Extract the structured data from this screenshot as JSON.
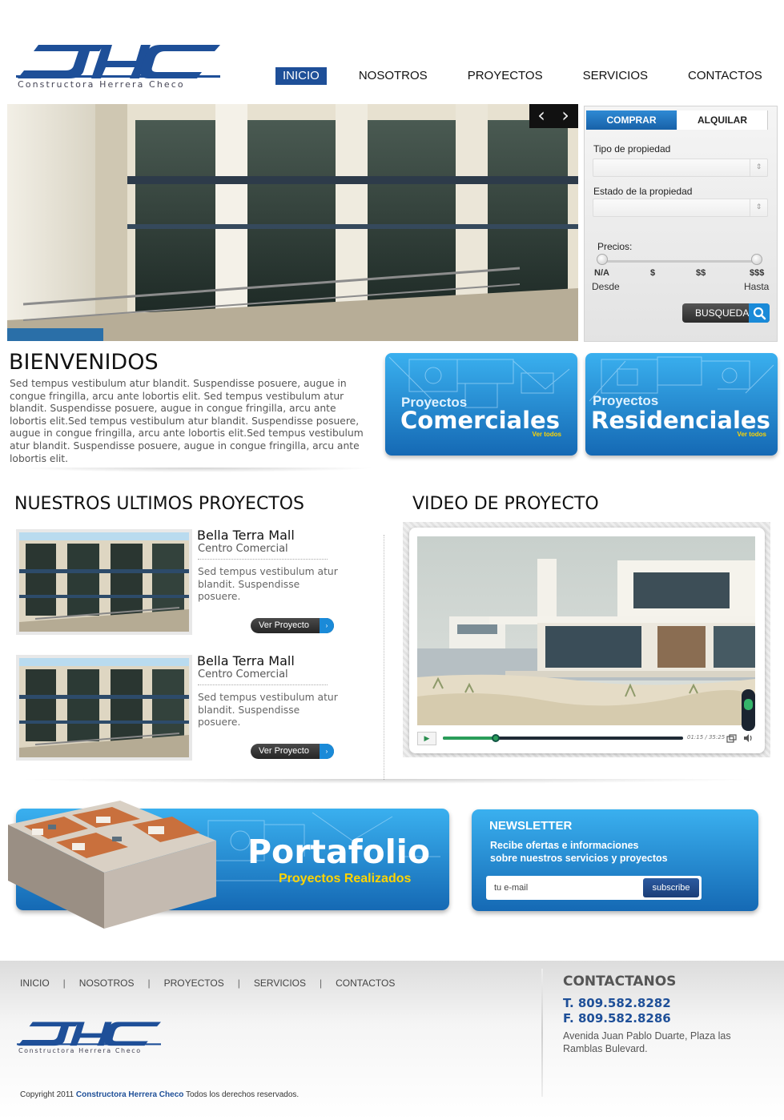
{
  "brand": {
    "name": "Constructora Herrera Checo",
    "color": "#1e4f98"
  },
  "nav": {
    "items": [
      {
        "label": "INICIO",
        "active": true
      },
      {
        "label": "NOSOTROS"
      },
      {
        "label": "PROYECTOS"
      },
      {
        "label": "SERVICIOS"
      },
      {
        "label": "CONTACTOS"
      }
    ]
  },
  "hero": {
    "prev_icon": "‹",
    "next_icon": "›"
  },
  "search": {
    "tabs": {
      "buy": "COMPRAR",
      "rent": "ALQUILAR"
    },
    "property_type_label": "Tipo de propiedad",
    "property_state_label": "Estado de la propiedad",
    "prices_label": "Precios:",
    "price_levels": [
      "N/A",
      "$",
      "$$",
      "$$$"
    ],
    "from_label": "Desde",
    "to_label": "Hasta",
    "button": "BUSQUEDA"
  },
  "welcome": {
    "title": "BIENVENIDOS",
    "text": "Sed tempus vestibulum atur blandit. Suspendisse posuere, augue in congue fringilla, arcu ante lobortis elit. Sed tempus vestibulum atur blandit. Suspendisse posuere, augue in congue fringilla, arcu ante lobortis elit.Sed tempus vestibulum atur blandit. Suspendisse posuere, augue in congue fringilla, arcu ante lobortis elit.Sed tempus vestibulum atur blandit. Suspendisse posuere, augue in congue fringilla, arcu ante lobortis elit."
  },
  "promos": {
    "commercial": {
      "small": "Proyectos",
      "big": "Comerciales",
      "link": "Ver todos"
    },
    "residential": {
      "small": "Proyectos",
      "big": "Residenciales",
      "link": "Ver todos"
    }
  },
  "projects": {
    "title": "NUESTROS ULTIMOS PROYECTOS",
    "items": [
      {
        "name": "Bella Terra Mall",
        "type": "Centro Comercial",
        "desc": "Sed tempus vestibulum atur blandit. Suspendisse posuere.",
        "button": "Ver Proyecto"
      },
      {
        "name": "Bella Terra Mall",
        "type": "Centro Comercial",
        "desc": "Sed tempus vestibulum atur blandit. Suspendisse posuere.",
        "button": "Ver Proyecto"
      }
    ]
  },
  "video": {
    "title": "VIDEO DE PROYECTO",
    "time": "01:15 / 35:25",
    "progress": 0.22
  },
  "portfolio": {
    "title": "Portafolio",
    "subtitle": "Proyectos Realizados"
  },
  "newsletter": {
    "title": "NEWSLETTER",
    "line1": "Recibe ofertas e informaciones",
    "line2": "sobre nuestros servicios y proyectos",
    "placeholder": "tu e-mail",
    "button": "subscribe"
  },
  "footer": {
    "nav": [
      "INICIO",
      "NOSOTROS",
      "PROYECTOS",
      "SERVICIOS",
      "CONTACTOS"
    ],
    "separator": "|",
    "contact_title": "CONTACTANOS",
    "phone": "T. 809.582.8282",
    "fax": "F. 809.582.8286",
    "address": "Avenida Juan Pablo Duarte, Plaza las Ramblas Bulevard.",
    "copyright_prefix": "Copyright 2011",
    "copyright_brand": "Constructora Herrera Checo",
    "copyright_suffix": "Todos los derechos reservados."
  }
}
